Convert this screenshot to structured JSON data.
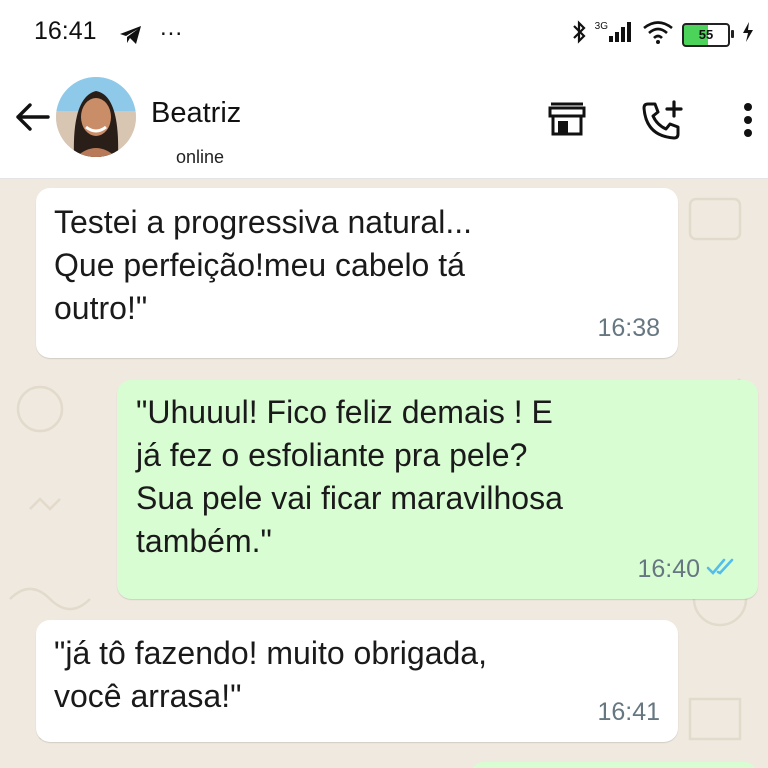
{
  "status_bar": {
    "time": "16:41",
    "more": "...",
    "network_label": "3G",
    "battery_level": "55"
  },
  "header": {
    "contact_name": "Beatriz",
    "contact_status": "online"
  },
  "messages": [
    {
      "direction": "in",
      "text": "Testei a progressiva natural...\nQue perfeição!meu cabelo tá\noutro!\"",
      "time": "16:38"
    },
    {
      "direction": "out",
      "text": "\"Uhuuul! Fico feliz demais ! E\njá fez o esfoliante pra pele?\nSua pele vai ficar maravilhosa\ntambém.\"",
      "time": "16:40",
      "read": true
    },
    {
      "direction": "in",
      "text": "\"já tô fazendo! muito obrigada,\nvocê arrasa!\"",
      "time": "16:41"
    }
  ],
  "colors": {
    "outgoing_bubble": "#d9fdd3",
    "incoming_bubble": "#ffffff",
    "read_ticks": "#53bdeb",
    "chat_background": "#efe9df"
  }
}
